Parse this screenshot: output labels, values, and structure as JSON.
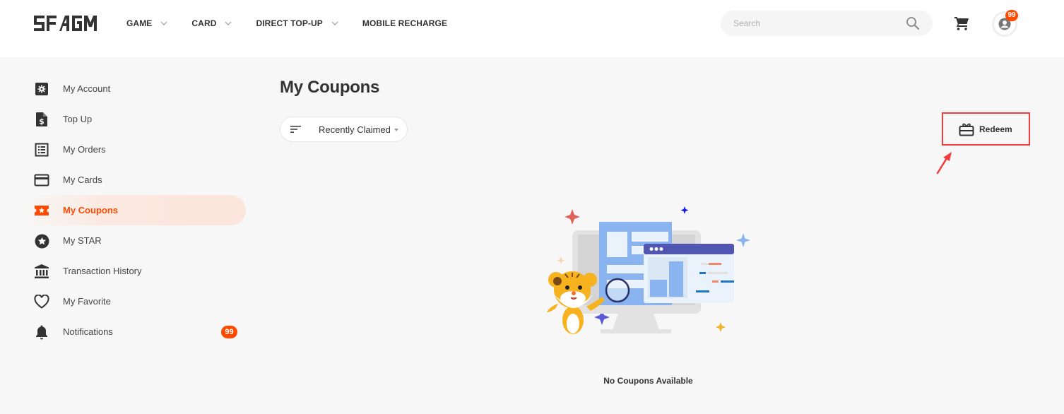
{
  "header": {
    "logo_text": "SEAGM",
    "nav": [
      {
        "label": "GAME",
        "has_dropdown": true
      },
      {
        "label": "CARD",
        "has_dropdown": true
      },
      {
        "label": "DIRECT TOP-UP",
        "has_dropdown": true
      },
      {
        "label": "MOBILE RECHARGE",
        "has_dropdown": false
      }
    ],
    "search": {
      "placeholder": "Search",
      "value": ""
    },
    "icons": {
      "search": "search-icon",
      "cart": "cart-icon",
      "avatar": "user-icon"
    },
    "avatar_badge": "99"
  },
  "sidebar": {
    "items": [
      {
        "label": "My Account",
        "icon": "gear-square-icon",
        "active": false
      },
      {
        "label": "Top Up",
        "icon": "dollar-file-icon",
        "active": false
      },
      {
        "label": "My Orders",
        "icon": "list-icon",
        "active": false
      },
      {
        "label": "My Cards",
        "icon": "credit-card-icon",
        "active": false
      },
      {
        "label": "My Coupons",
        "icon": "coupon-ticket-icon",
        "active": true
      },
      {
        "label": "My STAR",
        "icon": "star-circle-icon",
        "active": false
      },
      {
        "label": "Transaction History",
        "icon": "bank-icon",
        "active": false
      },
      {
        "label": "My Favorite",
        "icon": "heart-icon",
        "active": false
      },
      {
        "label": "Notifications",
        "icon": "bell-icon",
        "active": false,
        "badge": "99"
      }
    ]
  },
  "main": {
    "title": "My Coupons",
    "sort": {
      "label": "Recently Claimed",
      "icon": "sort-icon"
    },
    "redeem_label": "Redeem",
    "redeem_icon": "gift-card-icon",
    "empty_text": "No Coupons Available"
  },
  "colors": {
    "accent": "#ff4a00",
    "highlight_border": "#f23b3b",
    "background": "#f7f7f7",
    "text": "#333333"
  }
}
